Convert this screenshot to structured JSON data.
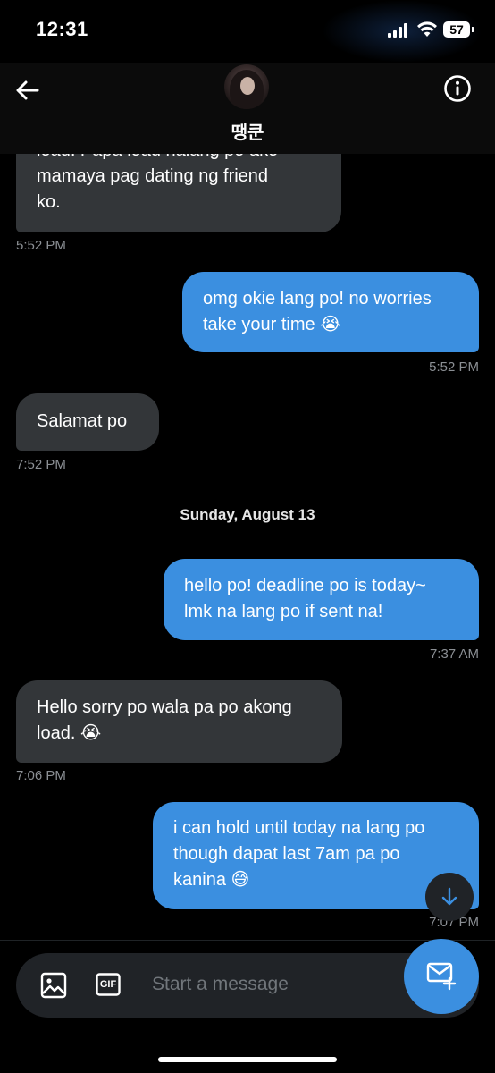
{
  "status_bar": {
    "time": "12:31",
    "battery": "57"
  },
  "header": {
    "contact_name": "땡쿤"
  },
  "messages": [
    {
      "dir": "in",
      "lines": [
        "load. Papa load nalang po ako",
        "mamaya pag dating ng friend",
        "ko."
      ],
      "time": "5:52 PM"
    },
    {
      "dir": "out",
      "lines": [
        "omg okie lang po! no worries",
        "take your time 😭"
      ],
      "time": "5:52 PM"
    },
    {
      "dir": "in",
      "lines": [
        "Salamat po"
      ],
      "time": "7:52 PM"
    },
    {
      "dir": "out",
      "lines": [
        "hello po! deadline po is today~",
        "lmk na lang po if sent na!"
      ],
      "time": "7:37 AM"
    },
    {
      "dir": "in",
      "lines": [
        "Hello sorry po wala pa po akong",
        "load. 😭"
      ],
      "time": "7:06 PM"
    },
    {
      "dir": "out",
      "lines": [
        "i can hold until today na lang po",
        "though dapat last 7am pa po",
        "kanina 😅"
      ],
      "time": "7:07 PM"
    }
  ],
  "date_separator": "Sunday, August 13",
  "composer": {
    "placeholder": "Start a message",
    "gif_label": "GIF"
  },
  "colors": {
    "outgoing": "#3b8fe0",
    "incoming": "#333639",
    "background": "#000000"
  }
}
